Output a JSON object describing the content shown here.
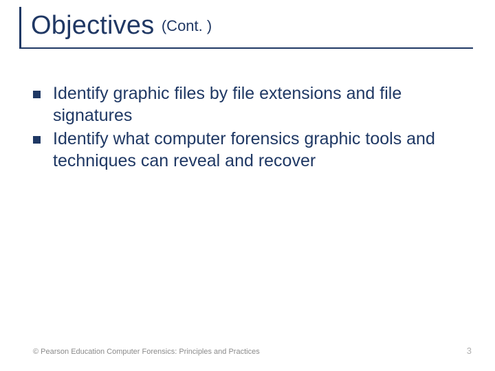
{
  "title": {
    "main": "Objectives",
    "suffix": "(Cont. )"
  },
  "bullets": [
    "Identify graphic files by file extensions and file signatures",
    "Identify what computer forensics graphic tools and techniques can reveal and recover"
  ],
  "footer": {
    "copyright": "© Pearson Education  Computer Forensics: Principles and Practices",
    "page": "3"
  }
}
